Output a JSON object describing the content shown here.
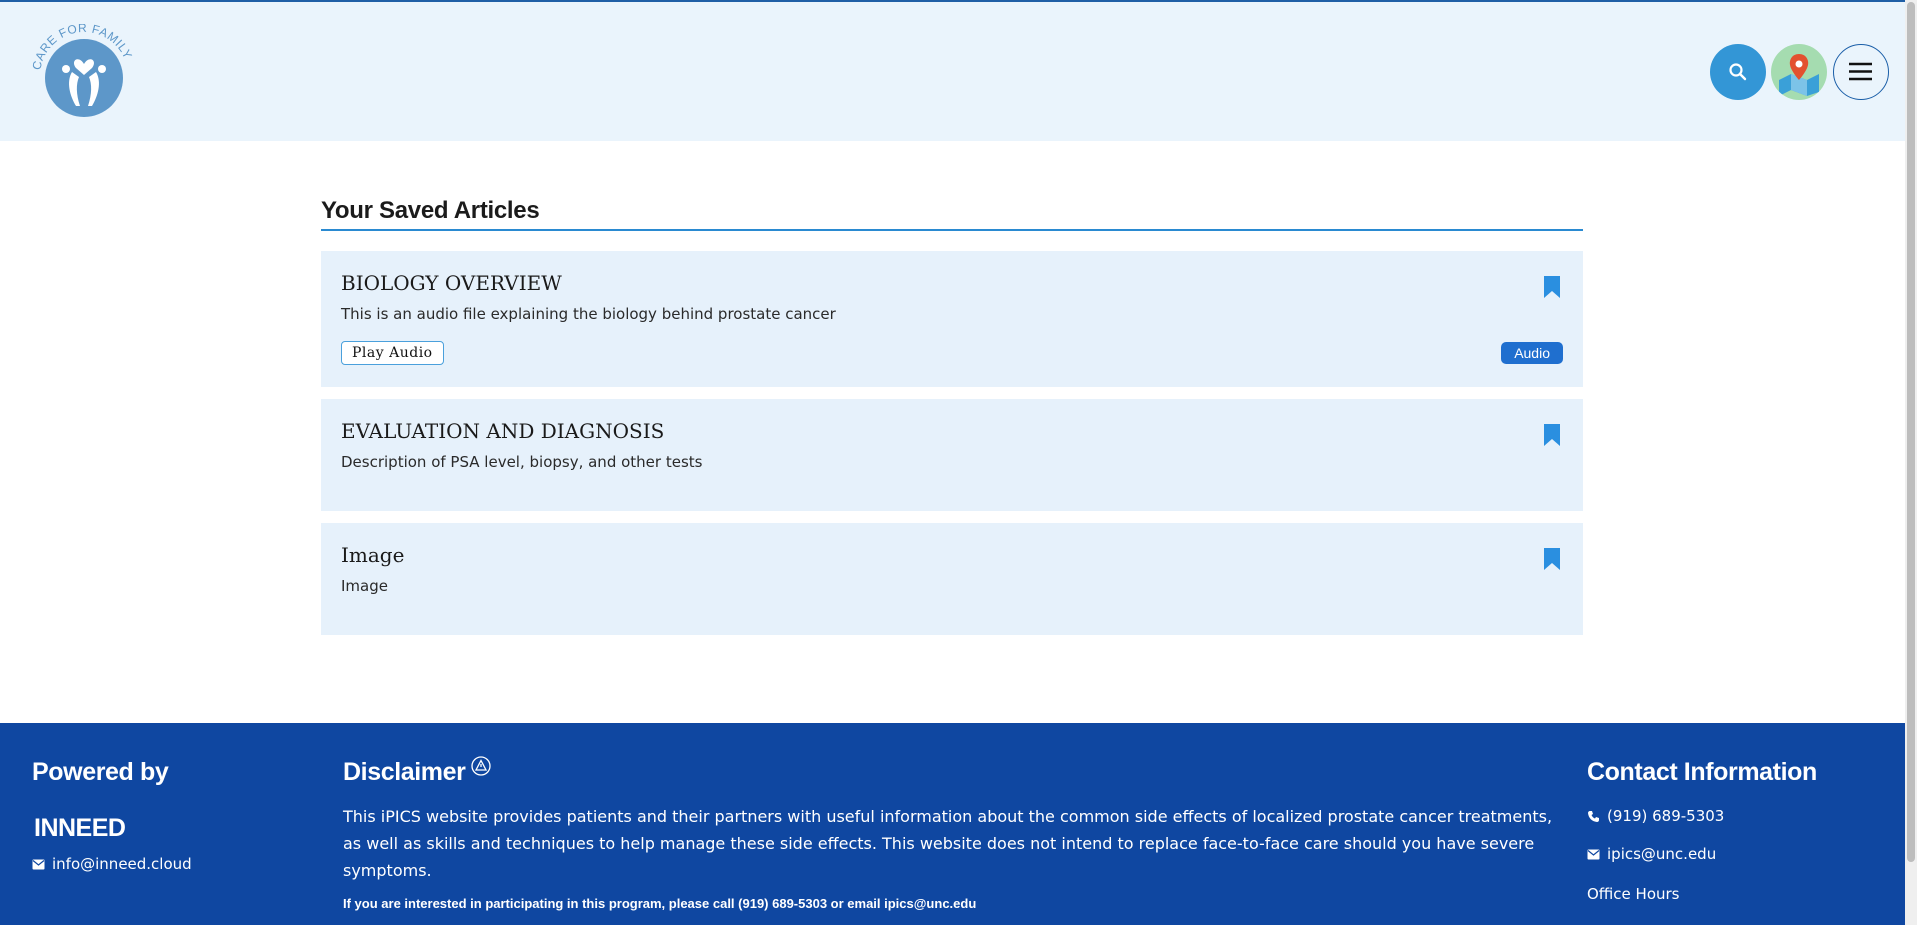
{
  "header": {
    "logo_text": "CARE FOR FAMILY",
    "search_button_icon": "search-icon",
    "map_button_icon": "map-pin-icon",
    "menu_button_icon": "hamburger-icon",
    "accent": "#3396d6"
  },
  "main": {
    "title": "Your Saved Articles",
    "articles": [
      {
        "title": "BIOLOGY OVERVIEW",
        "description": "This is an audio file explaining the biology behind prostate cancer",
        "action_label": "Play Audio",
        "tag": "Audio",
        "bookmark_icon": "bookmark-icon"
      },
      {
        "title": "EVALUATION AND DIAGNOSIS",
        "description": "Description of PSA level, biopsy, and other tests",
        "bookmark_icon": "bookmark-icon"
      },
      {
        "title": "Image",
        "description": "Image",
        "bookmark_icon": "bookmark-icon"
      }
    ]
  },
  "footer": {
    "background": "#0f47a1",
    "powered_by": {
      "title": "Powered by",
      "brand": "INNEED",
      "email": "info@inneed.cloud"
    },
    "disclaimer": {
      "title": "Disclaimer",
      "text": "This iPICS website provides patients and their partners with useful information about the common side effects of localized prostate cancer treatments, as well as skills and techniques to help manage these side effects. This website does not intend to replace face-to-face care should you have severe symptoms.",
      "contact_note": "If you are interested in participating in this program, please call (919) 689-5303 or email ipics@unc.edu"
    },
    "contact": {
      "title": "Contact Information",
      "phone": "(919) 689-5303",
      "email": "ipics@unc.edu",
      "office_hours_label": "Office Hours"
    }
  }
}
